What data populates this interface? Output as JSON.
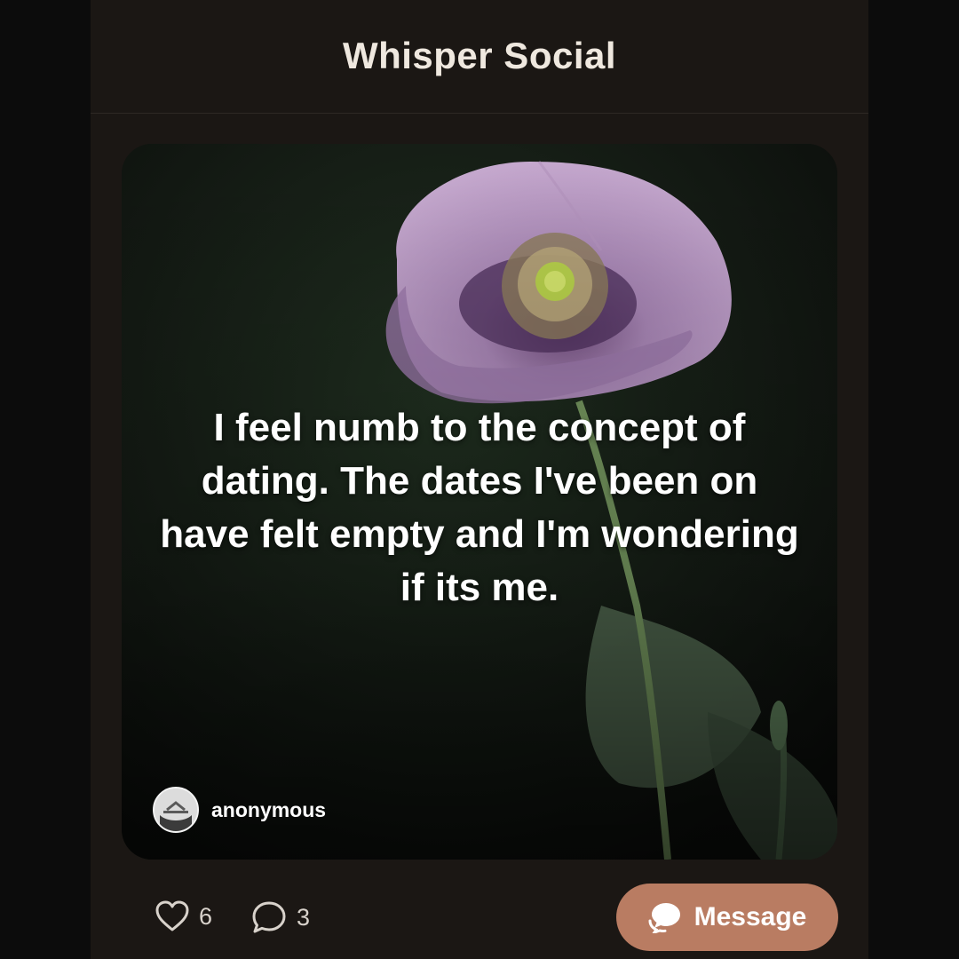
{
  "app": {
    "title": "Whisper Social"
  },
  "post": {
    "text": "I feel numb to the concept of dating. The dates I've been on have felt empty and I'm wondering if its me.",
    "author": "anonymous",
    "background": "purple poppy flower on dark green background"
  },
  "actions": {
    "likes": "6",
    "comments": "3",
    "message_label": "Message"
  },
  "colors": {
    "background": "#1b1714",
    "message_button": "#b97c62",
    "title_text": "#efe8df"
  },
  "icons": [
    "heart-icon",
    "comment-icon",
    "chat-bubbles-icon",
    "avatar-icon"
  ]
}
